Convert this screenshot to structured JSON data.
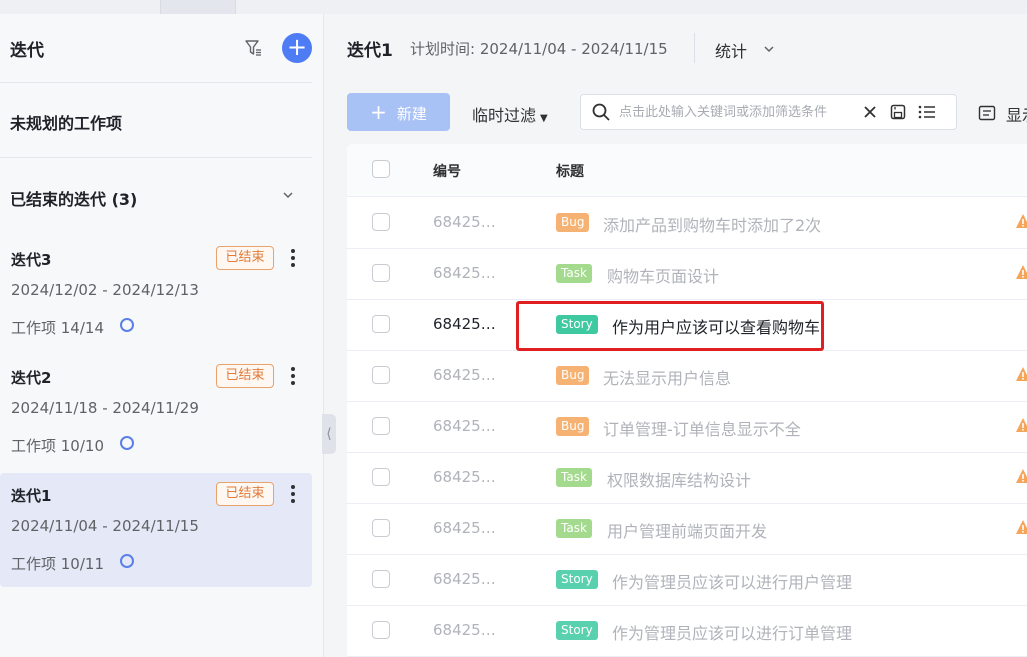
{
  "sidebar": {
    "title": "迭代",
    "unplanned": "未规划的工作项",
    "closed_header": "已结束的迭代 (3)",
    "sprints": [
      {
        "name": "迭代3",
        "dates": "2024/12/02 - 2024/12/13",
        "items": "工作项 14/14",
        "badge": "已结束"
      },
      {
        "name": "迭代2",
        "dates": "2024/11/18 - 2024/11/29",
        "items": "工作项 10/10",
        "badge": "已结束"
      },
      {
        "name": "迭代1",
        "dates": "2024/11/04 - 2024/11/15",
        "items": "工作项 10/11",
        "badge": "已结束"
      }
    ]
  },
  "header": {
    "title": "迭代1",
    "plan": "计划时间: 2024/11/04 - 2024/11/15",
    "stats": "统计"
  },
  "toolbar": {
    "new_label": "新建",
    "filter_label": "临时过滤",
    "search_placeholder": "点击此处输入关键词或添加筛选条件",
    "display_label": "显示"
  },
  "table": {
    "col_num": "编号",
    "col_title": "标题",
    "rows": [
      {
        "num": "68425…",
        "tag": "Bug",
        "title": "添加产品到购物车时添加了2次"
      },
      {
        "num": "68425…",
        "tag": "Task",
        "title": "购物车页面设计"
      },
      {
        "num": "68425…",
        "tag": "Story",
        "title": "作为用户应该可以查看购物车"
      },
      {
        "num": "68425…",
        "tag": "Bug",
        "title": "无法显示用户信息"
      },
      {
        "num": "68425…",
        "tag": "Bug",
        "title": "订单管理-订单信息显示不全"
      },
      {
        "num": "68425…",
        "tag": "Task",
        "title": "权限数据库结构设计"
      },
      {
        "num": "68425…",
        "tag": "Task",
        "title": "用户管理前端页面开发"
      },
      {
        "num": "68425…",
        "tag": "Story",
        "title": "作为管理员应该可以进行用户管理"
      },
      {
        "num": "68425…",
        "tag": "Story",
        "title": "作为管理员应该可以进行订单管理"
      }
    ]
  },
  "colors": {
    "accent": "#4d7cf5",
    "bug": "#f5a55a",
    "task": "#94d47a",
    "story": "#3ec9a0",
    "warning": "#f5a55a",
    "highlight": "#e02020"
  }
}
